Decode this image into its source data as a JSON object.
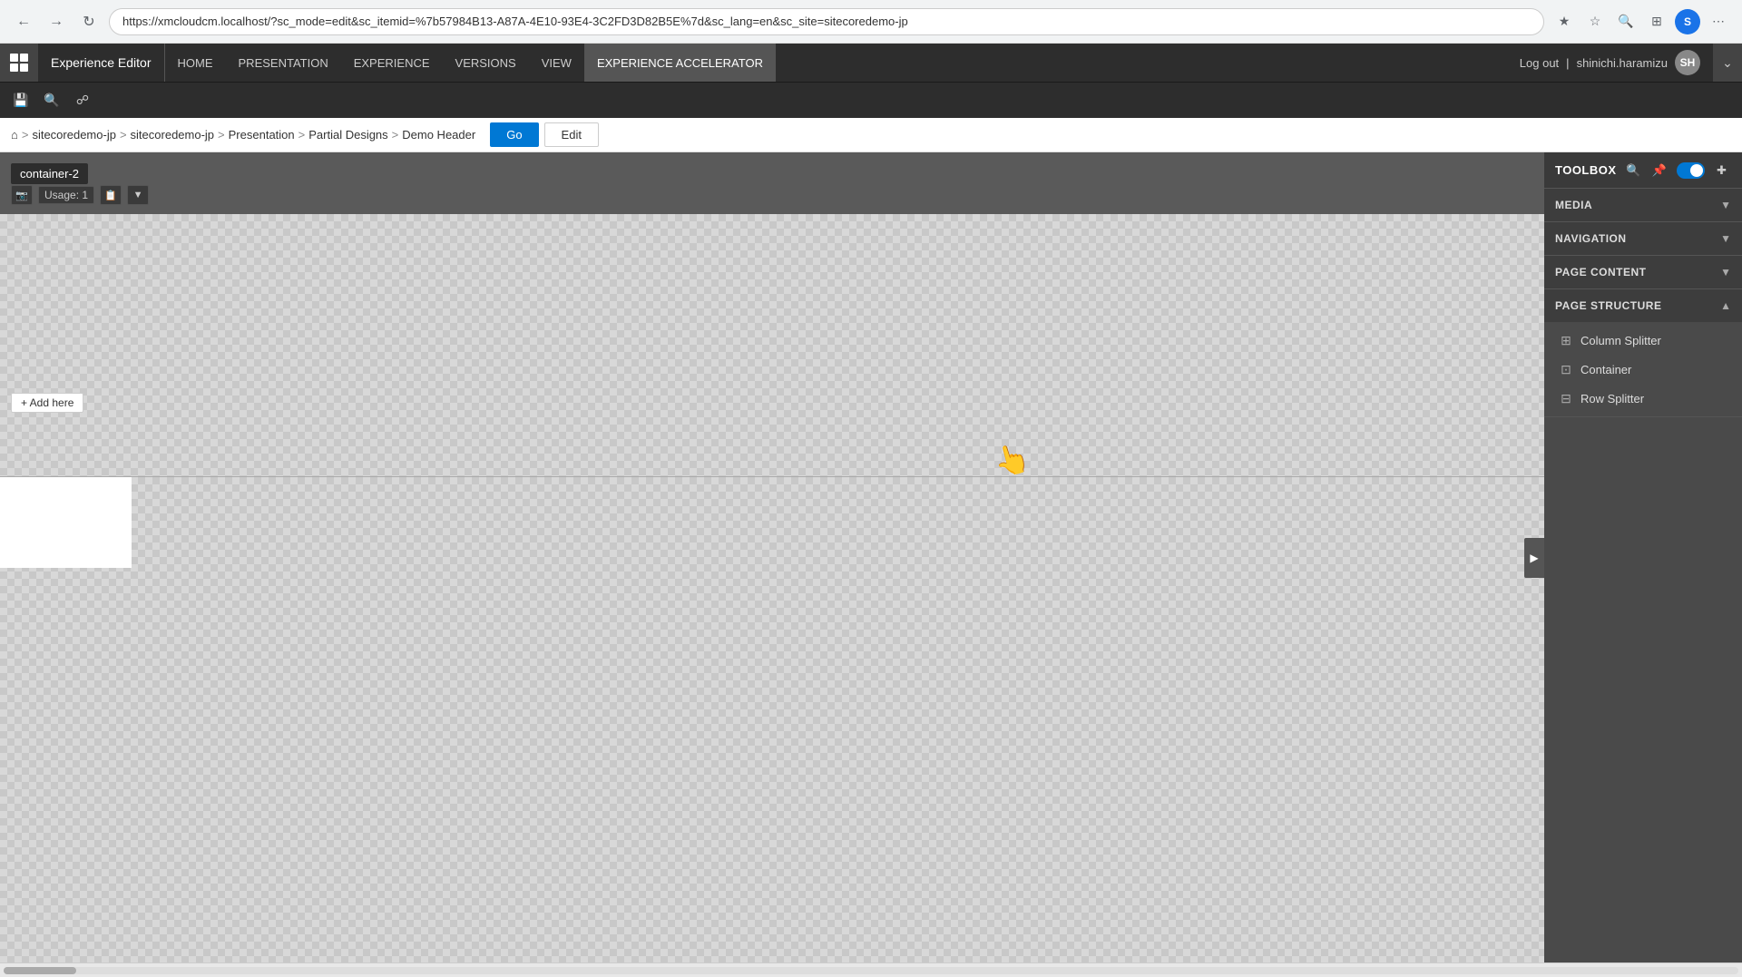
{
  "browser": {
    "url": "https://xmcloudcm.localhost/?sc_mode=edit&sc_itemid=%7b57984B13-A87A-4E10-93E4-3C2FD3D82B5E%7d&sc_lang=en&sc_site=sitecoredemo-jp",
    "back_title": "Back",
    "forward_title": "Forward",
    "refresh_title": "Refresh",
    "menu_title": "Menu"
  },
  "app": {
    "title": "Experience Editor",
    "logout_label": "Log out",
    "user_name": "shinichi.haramizu",
    "user_initials": "SH"
  },
  "menu": {
    "items": [
      {
        "id": "home",
        "label": "HOME"
      },
      {
        "id": "presentation",
        "label": "PRESENTATION"
      },
      {
        "id": "experience",
        "label": "EXPERIENCE"
      },
      {
        "id": "versions",
        "label": "VERSIONS"
      },
      {
        "id": "view",
        "label": "VIEW"
      },
      {
        "id": "experience-accelerator",
        "label": "EXPERIENCE ACCELERATOR",
        "active": true
      }
    ]
  },
  "breadcrumb": {
    "items": [
      {
        "id": "root",
        "label": "sitecoredemo-jp"
      },
      {
        "id": "site",
        "label": "sitecoredemo-jp"
      },
      {
        "id": "presentation",
        "label": "Presentation"
      },
      {
        "id": "partial-designs",
        "label": "Partial Designs"
      },
      {
        "id": "demo-header",
        "label": "Demo Header"
      }
    ],
    "go_label": "Go",
    "edit_label": "Edit"
  },
  "canvas": {
    "container_label": "container-2",
    "usage_label": "Usage: 1",
    "add_here_label": "+ Add here"
  },
  "toolbox": {
    "title": "TOOLBOX",
    "sections": [
      {
        "id": "media",
        "label": "MEDIA",
        "expanded": false,
        "items": []
      },
      {
        "id": "navigation",
        "label": "NAVIGATION",
        "expanded": false,
        "items": []
      },
      {
        "id": "page-content",
        "label": "PAGE CONTENT",
        "expanded": false,
        "items": []
      },
      {
        "id": "page-structure",
        "label": "PAGE STRUCTURE",
        "expanded": true,
        "items": [
          {
            "id": "column-splitter",
            "label": "Column Splitter",
            "icon": "⊞"
          },
          {
            "id": "container",
            "label": "Container",
            "icon": "⊡"
          },
          {
            "id": "row-splitter",
            "label": "Row Splitter",
            "icon": "⊟"
          }
        ]
      }
    ]
  }
}
